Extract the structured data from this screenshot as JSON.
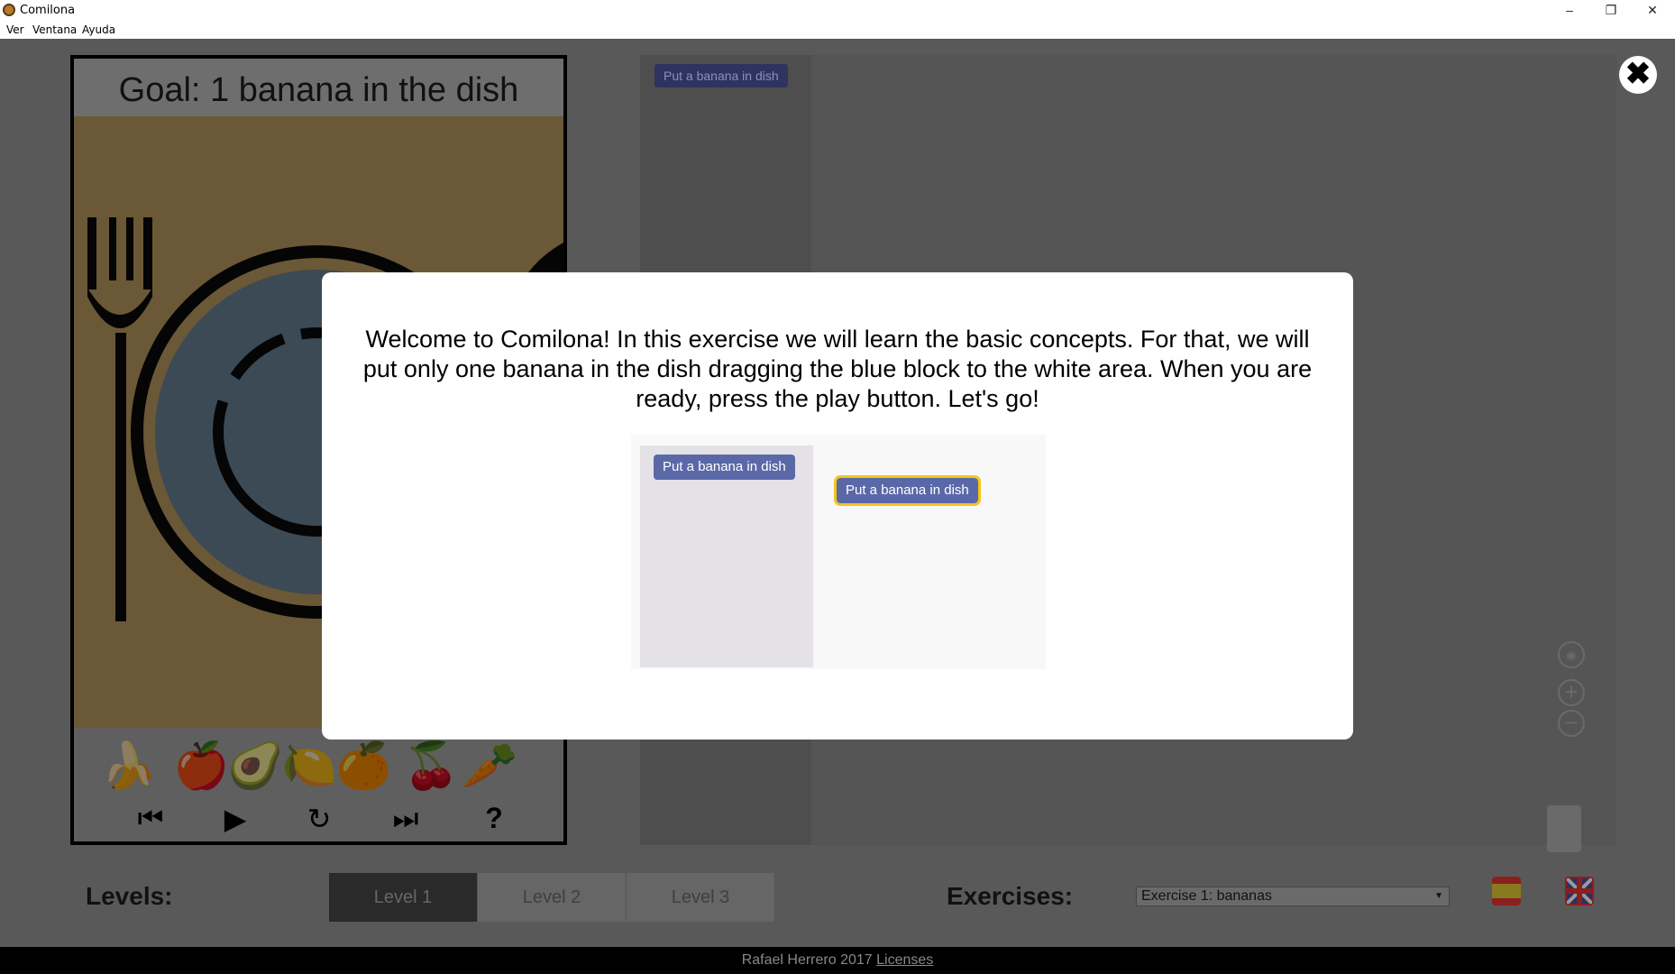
{
  "window": {
    "title": "Comilona",
    "minimize_glyph": "–",
    "restore_glyph": "❐",
    "close_glyph": "✕"
  },
  "menu": {
    "items": [
      "Ver",
      "Ventana",
      "Ayuda"
    ]
  },
  "stage": {
    "goal": "Goal: 1 banana in the dish",
    "fruits": [
      "🍌",
      "🍎",
      "🥑",
      "🍋",
      "🍊",
      "🍒",
      "🥕"
    ],
    "controls": {
      "first": "⏮",
      "play": "▶",
      "reset": "↻",
      "next": "⏭",
      "help": "?"
    }
  },
  "palette": {
    "block_label": "Put a banana in dish"
  },
  "modal": {
    "message": "Welcome to Comilona! In this exercise we will learn the basic concepts. For that, we will put only one banana in the dish dragging the blue block to the white area. When you are ready, press the play button. Let's go!",
    "demo_palette_block": "Put a banana in dish",
    "demo_workspace_block": "Put a banana in dish"
  },
  "close_button": "✖",
  "bottom": {
    "levels_label": "Levels:",
    "levels": [
      "Level 1",
      "Level 2",
      "Level 3"
    ],
    "active_level": "Level 1",
    "exercises_label": "Exercises:",
    "exercise_selected": "Exercise 1: bananas",
    "flags": [
      "spain-flag",
      "uk-flag"
    ]
  },
  "footer": {
    "credit": "Rafael Herrero 2017",
    "licenses_link": "Licenses"
  },
  "colors": {
    "block_blue": "#5b68a8",
    "block_highlight": "#f5c518",
    "overlay": "#595959",
    "footer": "#000000"
  }
}
